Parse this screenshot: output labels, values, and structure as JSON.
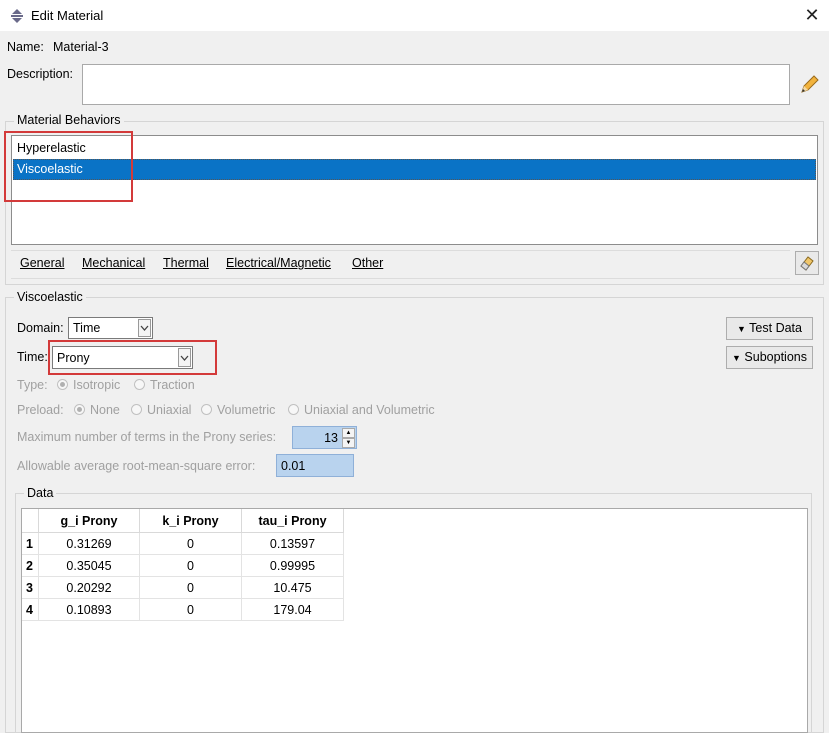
{
  "window": {
    "title": "Edit Material",
    "close_glyph": "✕"
  },
  "name": {
    "label": "Name:",
    "value": "Material-3"
  },
  "description": {
    "label": "Description:",
    "value": ""
  },
  "behaviors": {
    "group_title": "Material Behaviors",
    "items": [
      {
        "label": "Hyperelastic",
        "selected": false
      },
      {
        "label": "Viscoelastic",
        "selected": true
      }
    ]
  },
  "menu": [
    "General",
    "Mechanical",
    "Thermal",
    "Electrical/Magnetic",
    "Other"
  ],
  "viscoelastic": {
    "group_title": "Viscoelastic",
    "domain_label": "Domain:",
    "domain_value": "Time",
    "time_label": "Time:",
    "time_value": "Prony",
    "type_label": "Type:",
    "type_options": [
      "Isotropic",
      "Traction"
    ],
    "type_selected": "Isotropic",
    "preload_label": "Preload:",
    "preload_options": [
      "None",
      "Uniaxial",
      "Volumetric",
      "Uniaxial and Volumetric"
    ],
    "preload_selected": "None",
    "max_terms_label": "Maximum number of terms in the Prony series:",
    "max_terms_value": "13",
    "rms_label": "Allowable average root-mean-square error:",
    "rms_value": "0.01",
    "test_data_button": "Test Data",
    "suboptions_button": "Suboptions"
  },
  "data": {
    "group_title": "Data",
    "columns": [
      "g_i Prony",
      "k_i Prony",
      "tau_i Prony"
    ],
    "rows": [
      {
        "index": "1",
        "values": [
          "0.31269",
          "0",
          "0.13597"
        ]
      },
      {
        "index": "2",
        "values": [
          "0.35045",
          "0",
          "0.99995"
        ]
      },
      {
        "index": "3",
        "values": [
          "0.20292",
          "0",
          "10.475"
        ]
      },
      {
        "index": "4",
        "values": [
          "0.10893",
          "0",
          "179.04"
        ]
      }
    ]
  },
  "colors": {
    "selection": "#0a73c6",
    "highlight_box": "#d33a3a",
    "input_highlight": "#b9d3ee"
  }
}
